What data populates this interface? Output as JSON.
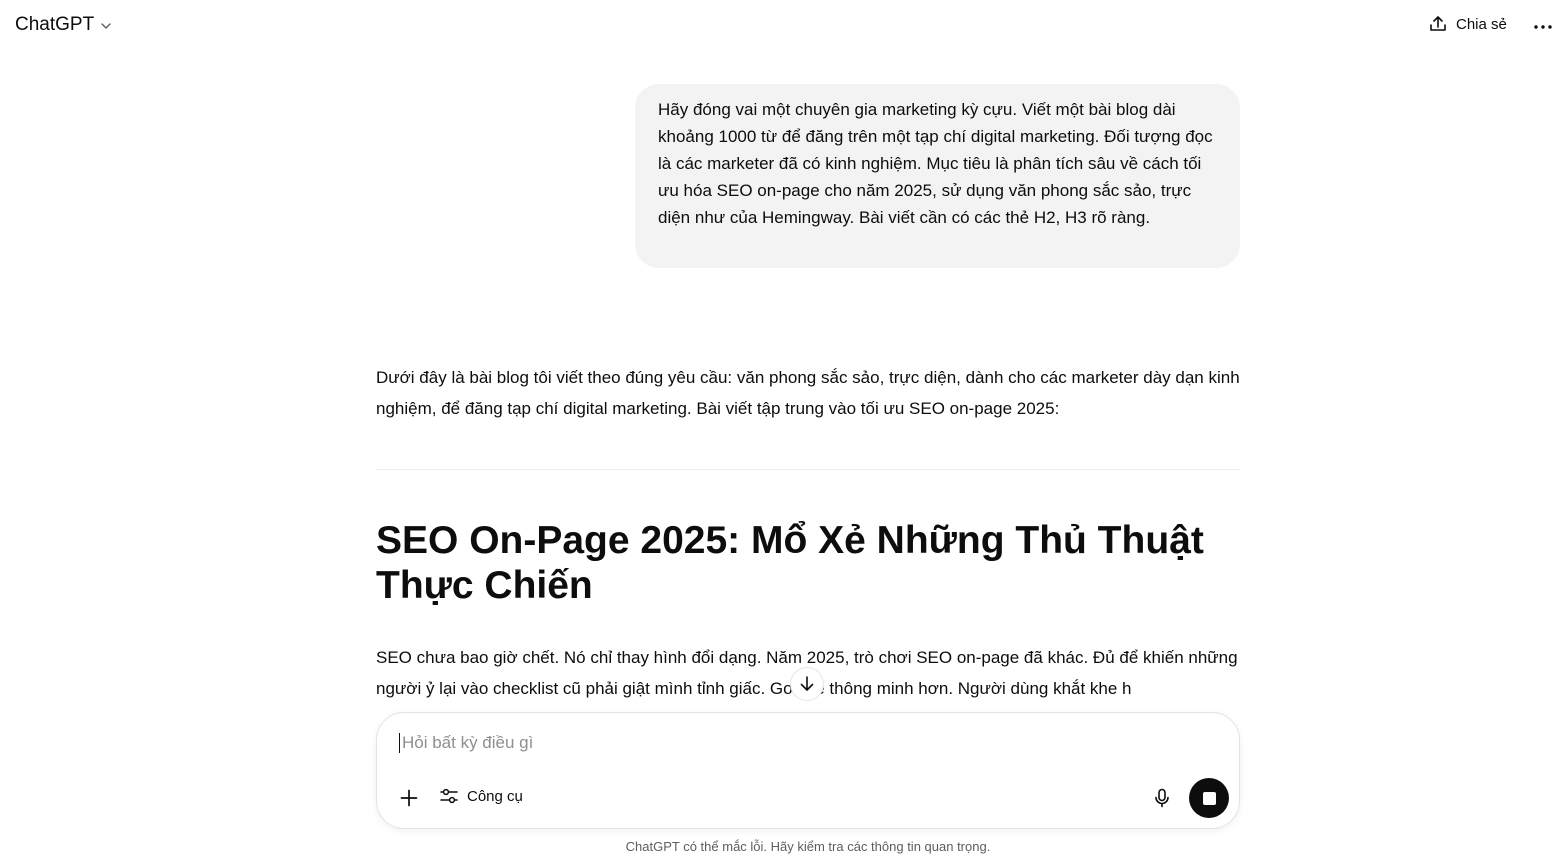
{
  "header": {
    "model_name": "ChatGPT",
    "share_label": "Chia sẻ"
  },
  "conversation": {
    "user_message": "Hãy đóng vai một chuyên gia marketing kỳ cựu. Viết một bài blog dài khoảng 1000 từ để đăng trên một tạp chí digital marketing. Đối tượng đọc là các marketer đã có kinh nghiệm. Mục tiêu là phân tích sâu về cách tối ưu hóa SEO on-page cho năm 2025, sử dụng văn phong sắc sảo, trực diện như của Hemingway. Bài viết cần có các thẻ H2, H3 rõ ràng.",
    "assistant_intro": "Dưới đây là bài blog tôi viết theo đúng yêu cầu: văn phong sắc sảo, trực diện, dành cho các marketer dày dạn kinh nghiệm, để đăng tạp chí digital marketing. Bài viết tập trung vào tối ưu SEO on-page 2025:",
    "article_title": "SEO On-Page 2025: Mổ Xẻ Những Thủ Thuật Thực Chiến",
    "article_paragraph": "SEO chưa bao giờ chết. Nó chỉ thay hình đổi dạng. Năm 2025, trò chơi SEO on-page đã khác. Đủ để khiến những người ỷ lại vào checklist cũ phải giật mình tỉnh giấc. Google thông minh hơn. Người dùng khắt khe h"
  },
  "composer": {
    "placeholder": "Hỏi bất kỳ điều gì",
    "value": "",
    "tools_label": "Công cụ"
  },
  "footer": {
    "disclaimer": "ChatGPT có thể mắc lỗi. Hãy kiểm tra các thông tin quan trọng."
  }
}
